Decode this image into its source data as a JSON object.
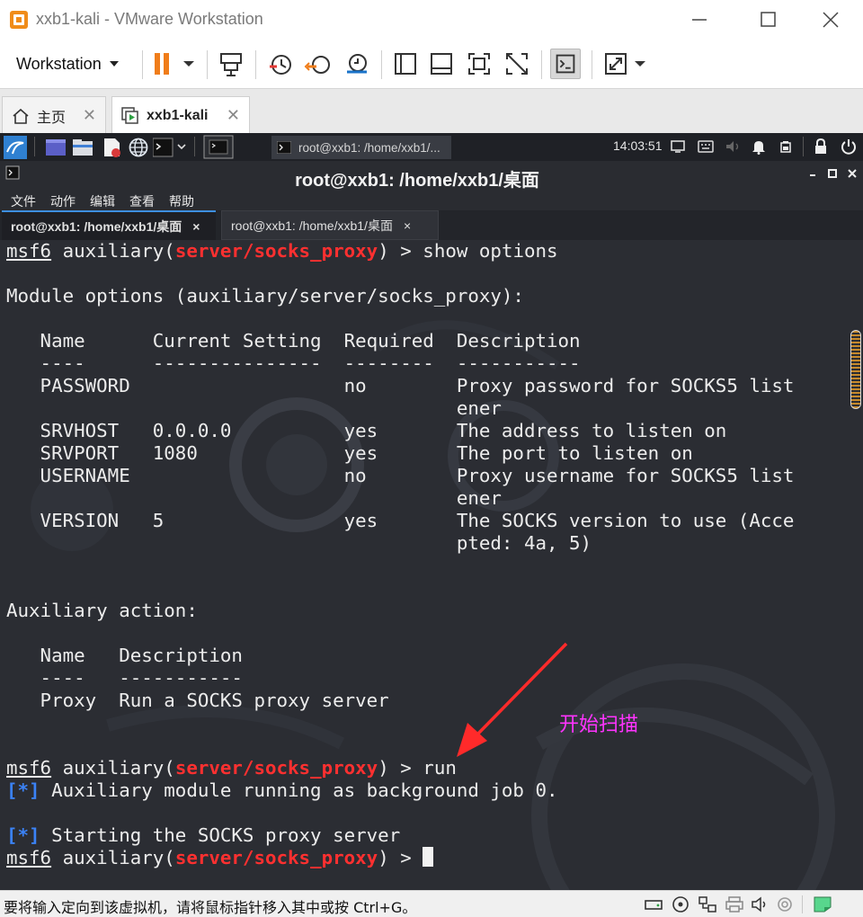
{
  "window": {
    "title": "xxb1-kali - VMware Workstation"
  },
  "toolbar": {
    "workstation_menu": "Workstation"
  },
  "vm_tabs": [
    {
      "label": "主页",
      "close": "✕"
    },
    {
      "label": "xxb1-kali",
      "close": "✕"
    }
  ],
  "kali_panel": {
    "task_label": "root@xxb1: /home/xxb1/...",
    "clock": "14:03:51"
  },
  "terminal": {
    "title": "root@xxb1: /home/xxb1/桌面",
    "menu": [
      "文件",
      "动作",
      "编辑",
      "查看",
      "帮助"
    ],
    "tabs": [
      {
        "label": "root@xxb1: /home/xxb1/桌面",
        "close": "×"
      },
      {
        "label": "root@xxb1: /home/xxb1/桌面",
        "close": "×"
      }
    ],
    "prompt": {
      "msf": "msf6",
      "aux": " auxiliary(",
      "module": "server/socks_proxy",
      "tail": ") > "
    },
    "cmd_show": "show options",
    "cmd_run": "run",
    "module_options_header": "Module options (auxiliary/server/socks_proxy):",
    "options_header": "   Name      Current Setting  Required  Description",
    "options_rule": "   ----      ---------------  --------  -----------",
    "options_rows": [
      "   PASSWORD                   no        Proxy password for SOCKS5 list",
      "                                        ener",
      "   SRVHOST   0.0.0.0          yes       The address to listen on",
      "   SRVPORT   1080             yes       The port to listen on",
      "   USERNAME                   no        Proxy username for SOCKS5 list",
      "                                        ener",
      "   VERSION   5                yes       The SOCKS version to use (Acce",
      "                                        pted: 4a, 5)"
    ],
    "action_header": "Auxiliary action:",
    "action_cols": "   Name   Description",
    "action_rule": "   ----   -----------",
    "action_row": "   Proxy  Run a SOCKS proxy server",
    "status_tag": "[*]",
    "status_1": " Auxiliary module running as background job 0.",
    "status_2": " Starting the SOCKS proxy server"
  },
  "annotation": {
    "text": "开始扫描",
    "color": "#ff33ff",
    "arrow_color": "#ff2a2a"
  },
  "statusbar": {
    "text": "要将输入定向到该虚拟机，请将鼠标指针移入其中或按 Ctrl+G。"
  },
  "colors": {
    "module_red": "#ff3030",
    "status_blue": "#3b82f6",
    "terminal_bg": "#2b2d33",
    "tab_accent": "#3d8fe0"
  }
}
